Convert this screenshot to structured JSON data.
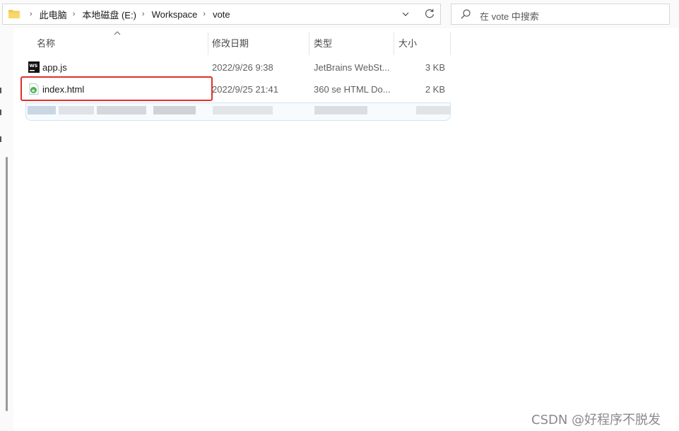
{
  "address_bar": {
    "breadcrumbs": [
      "此电脑",
      "本地磁盘 (E:)",
      "Workspace",
      "vote"
    ]
  },
  "search": {
    "placeholder": "在 vote 中搜索"
  },
  "columns": {
    "name": "名称",
    "modified": "修改日期",
    "type": "类型",
    "size": "大小"
  },
  "files": [
    {
      "name": "app.js",
      "modified": "2022/9/26 9:38",
      "type": "JetBrains WebSt...",
      "size": "3 KB",
      "icon": "webstorm-file-icon"
    },
    {
      "name": "index.html",
      "modified": "2022/9/25 21:41",
      "type": "360 se HTML Do...",
      "size": "2 KB",
      "icon": "html-360-browser-file-icon"
    }
  ],
  "highlight": {
    "file": "index.html",
    "color": "#e0302a"
  },
  "watermark": "CSDN @好程序不脱发",
  "colors": {
    "folder": "#f2c94c",
    "selection_border": "#cfe6f7",
    "highlight_red": "#e0302a"
  }
}
